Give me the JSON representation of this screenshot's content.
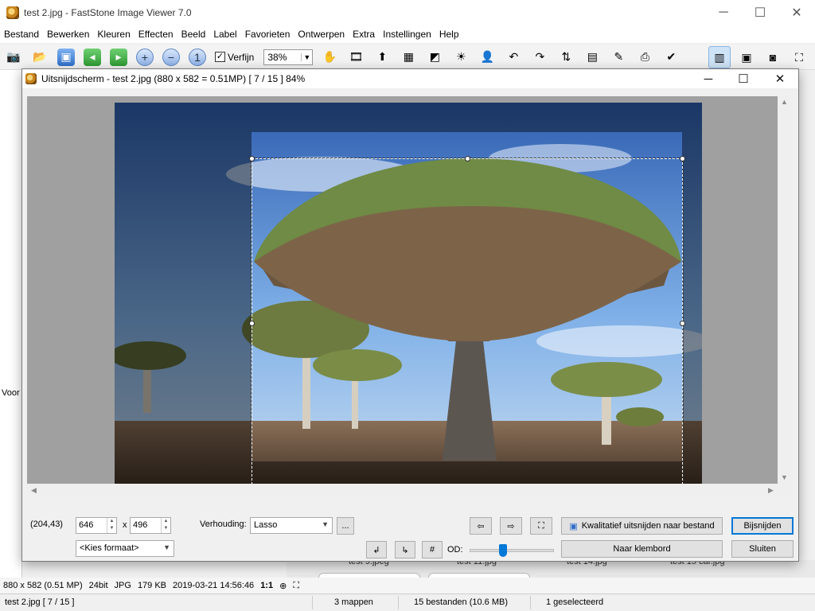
{
  "window": {
    "title": "test 2.jpg  -  FastStone Image Viewer 7.0",
    "minimize": "─",
    "maximize": "☐",
    "close": "✕"
  },
  "menu": [
    "Bestand",
    "Bewerken",
    "Kleuren",
    "Effecten",
    "Beeld",
    "Label",
    "Favorieten",
    "Ontwerpen",
    "Extra",
    "Instellingen",
    "Help"
  ],
  "toolbar": {
    "smooth_label": "Verfijn",
    "smooth_checked": "✓",
    "zoom_value": "38%",
    "zoom_arrow": "▼"
  },
  "leftpanel": {
    "label": "Voor"
  },
  "thumbs": [
    "test 9.jpeg",
    "test 11.jpg",
    "test 14.jpg",
    "test 15 car.jpg"
  ],
  "infobar": {
    "dimensions": "880 x 582 (0.51 MP)",
    "bitdepth": "24bit",
    "format": "JPG",
    "size": "179 KB",
    "datetime": "2019-03-21 14:56:46",
    "ratio": "1:1"
  },
  "statusbar": {
    "file": "test 2.jpg [ 7 / 15 ]",
    "folders": "3 mappen",
    "files": "15 bestanden (10.6 MB)",
    "selected": "1 geselecteerd"
  },
  "dialog": {
    "title": "Uitsnijdscherm  -  test 2.jpg  (880 x 582 = 0.51MP)  [ 7 / 15 ]   84%",
    "coords": "(204,43)",
    "width": "646",
    "height": "496",
    "x": "x",
    "format_select": "<Kies formaat>",
    "ratio_label": "Verhouding:",
    "ratio_value": "Lasso",
    "ellipsis": "...",
    "od_label": "OD:",
    "save_button": "Kwalitatief uitsnijden naar bestand",
    "clipboard_button": "Naar klembord",
    "crop_button": "Bijsnijden",
    "close_button": "Sluiten"
  }
}
